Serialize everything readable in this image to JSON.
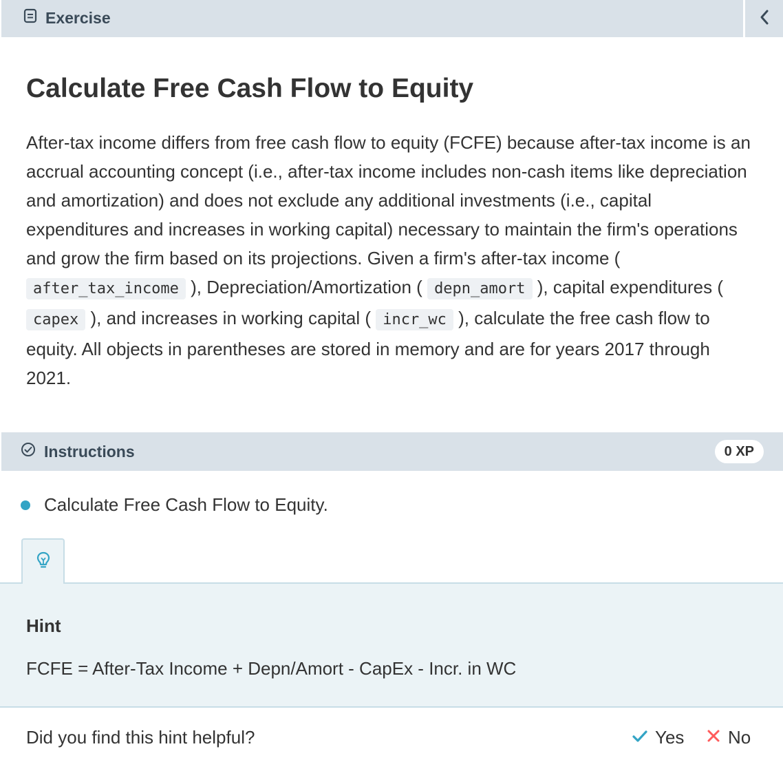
{
  "header": {
    "title": "Exercise",
    "icon": "exercise-doc-icon",
    "collapse_icon": "chevron-left-icon"
  },
  "exercise": {
    "title": "Calculate Free Cash Flow to Equity",
    "desc": {
      "p1": "After-tax income differs from free cash flow to equity (FCFE) because after-tax income is an accrual accounting concept (i.e., after-tax income includes non-cash items like depreciation and amortization) and does not exclude any additional investments (i.e., capital expenditures and increases in working capital) necessary to maintain the firm's operations and grow the firm based on its projections. Given a firm's after-tax income ( ",
      "code1": "after_tax_income",
      "p2": " ), Depreciation/Amortization ( ",
      "code2": "depn_amort",
      "p3": " ), capital expenditures ( ",
      "code3": "capex",
      "p4": " ), and increases in working capital ( ",
      "code4": "incr_wc",
      "p5": " ), calculate the free cash flow to equity. All objects in parentheses are stored in memory and are for years 2017 through 2021."
    }
  },
  "instructions": {
    "label": "Instructions",
    "xp": "0 XP",
    "items": [
      "Calculate Free Cash Flow to Equity."
    ]
  },
  "hint": {
    "heading": "Hint",
    "text": "FCFE = After-Tax Income + Depn/Amort - CapEx - Incr. in WC"
  },
  "feedback": {
    "question": "Did you find this hint helpful?",
    "yes": "Yes",
    "no": "No",
    "colors": {
      "yes": "#33a4c5",
      "no": "#ff5b5b"
    }
  }
}
